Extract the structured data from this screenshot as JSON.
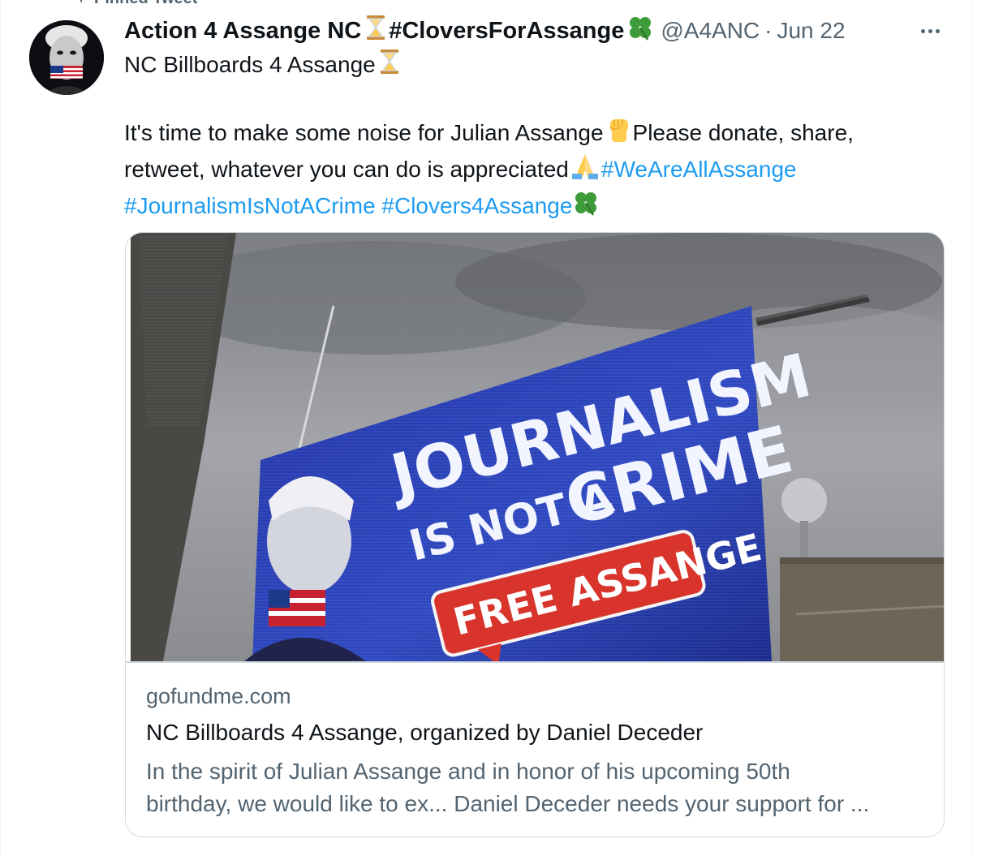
{
  "pinned": {
    "label": "Pinned Tweet"
  },
  "tweet": {
    "display_name_part1": "Action 4 Assange NC",
    "display_name_part2": "#CloversForAssange",
    "handle": "@A4ANC",
    "separator": "·",
    "time": "Jun 22",
    "lines": {
      "l1_text": "NC Billboards 4 Assange",
      "l3_text_a": "It's time to make some noise for Julian Assange",
      "l3_text_b": "Please donate, share,",
      "l4_text": "retweet, whatever you can do is appreciated",
      "hashtag_1": "#WeAreAllAssange",
      "hashtag_2": "#JournalismIsNotACrime",
      "hashtag_3": "#Clovers4Assange"
    }
  },
  "card": {
    "image_alt": "Billboard: Journalism is not a crime — Free Assange",
    "billboard_line1": "JOURNALISM",
    "billboard_line2a": "IS NOT A",
    "billboard_line2b": "CRIME",
    "billboard_button": "FREE ASSANGE",
    "domain": "gofundme.com",
    "title": "NC Billboards 4 Assange, organized by Daniel Deceder",
    "desc_line1": "In the spirit of Julian Assange and in honor of his upcoming 50th",
    "desc_line2": "birthday, we would like to ex... Daniel Deceder needs your support for ..."
  },
  "icons": {
    "pin": "pin-icon",
    "hourglass": "hourglass-icon",
    "clover": "four-leaf-clover-icon",
    "fist": "raised-fist-icon",
    "pray": "folded-hands-icon",
    "more": "more-icon"
  },
  "colors": {
    "text": "#0f1419",
    "secondary": "#536471",
    "link": "#1d9bf0",
    "border": "#cfd9de",
    "billboard_blue": "#2a3fae",
    "billboard_red": "#d8342c"
  }
}
